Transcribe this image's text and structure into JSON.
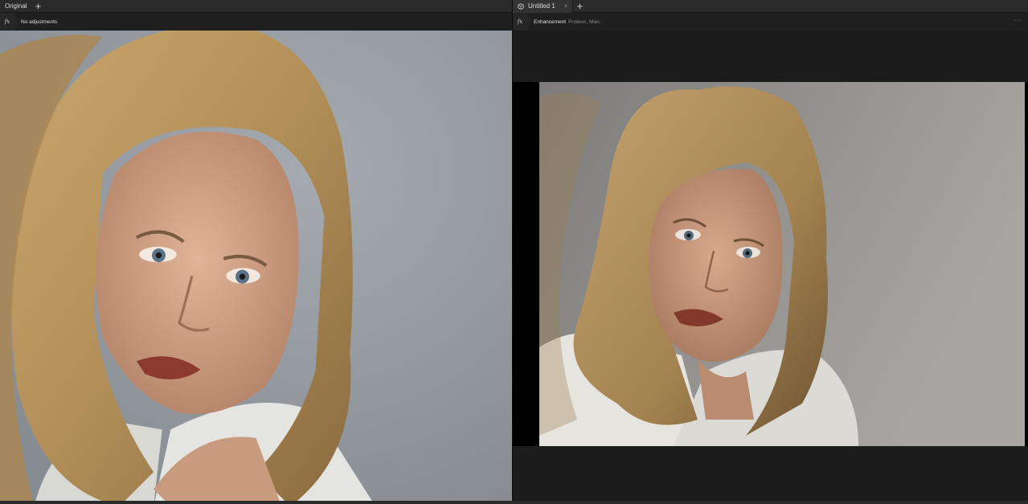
{
  "left_pane": {
    "tab_label": "Original",
    "adjustment_text": "No adjustments",
    "fx_label": "fx",
    "add_icon": "plus-icon"
  },
  "right_pane": {
    "tab_label": "Untitled 1",
    "tab_icon": "cube-icon",
    "tab_close": "×",
    "add_icon": "plus-icon",
    "fx_label": "fx",
    "adjustment_text": "Enhancement",
    "adjustment_detail": "Proteus, Man.",
    "more_label": "···"
  },
  "colors": {
    "background": "#1c1c1c",
    "tabbar": "#2a2a2a",
    "photo_wall": "#8f959a"
  }
}
